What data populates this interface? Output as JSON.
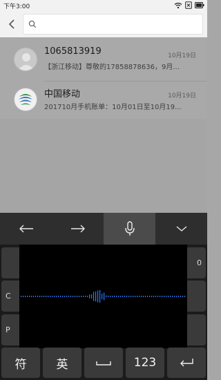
{
  "status": {
    "time": "下午3:00",
    "battery_label": "x"
  },
  "search": {
    "placeholder": ""
  },
  "messages": [
    {
      "sender": "1065813919",
      "preview": "【浙江移动】尊敬的17858878636，9月...",
      "date": "10月19日",
      "avatar": "person-avatar-icon"
    },
    {
      "sender": "中国移动",
      "preview": "201710月手机账单：10月01日至10月19...",
      "date": "10月19日",
      "avatar": "china-mobile-logo-icon"
    }
  ],
  "keyboard": {
    "toolbar": [
      "arrow-left-icon",
      "arrow-right-icon",
      "microphone-icon",
      "chevron-down-icon"
    ],
    "row_partial_letters": [
      "",
      "0",
      "C",
      "P"
    ],
    "bottom_keys": {
      "symbols": "符",
      "english": "英",
      "space": "",
      "numbers": "123",
      "enter": ""
    }
  },
  "colors": {
    "dim_overlay": "#a7a7a7",
    "keyboard_bg": "#1b1b1b",
    "key_bg": "#3a3a3a",
    "wave_color": "#2f7bff"
  }
}
